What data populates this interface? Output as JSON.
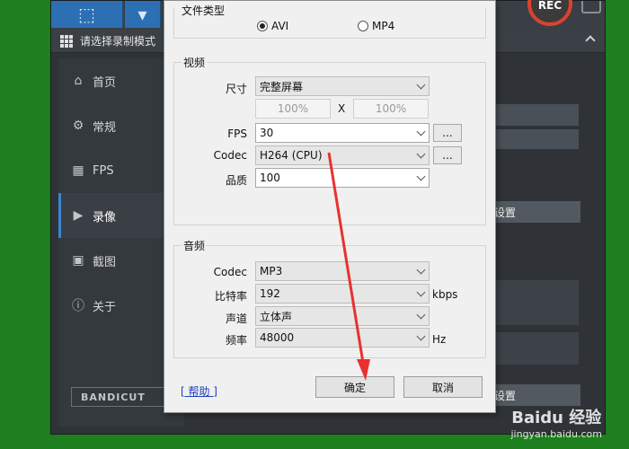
{
  "app": {
    "mode_bar_title": "请选择录制模式",
    "rec_label": "REC",
    "sidebar": [
      {
        "label": "首页",
        "icon": "home-icon"
      },
      {
        "label": "常规",
        "icon": "gear-icon"
      },
      {
        "label": "FPS",
        "icon": "fps-icon"
      },
      {
        "label": "录像",
        "icon": "video-icon",
        "active": true
      },
      {
        "label": "截图",
        "icon": "image-icon"
      },
      {
        "label": "关于",
        "icon": "info-icon"
      }
    ],
    "bandicut_logo": "BANDICUT",
    "right_button_1": "设置",
    "right_button_2": "设置"
  },
  "dialog": {
    "file_type_title": "文件类型",
    "format_options": [
      "AVI",
      "MP4"
    ],
    "format_selected": "AVI",
    "video": {
      "title": "视频",
      "size_label": "尺寸",
      "size_value": "完整屏幕",
      "width_pct": "100%",
      "x_label": "X",
      "height_pct": "100%",
      "fps_label": "FPS",
      "fps_value": "30",
      "codec_label": "Codec",
      "codec_value": "H264 (CPU)",
      "quality_label": "品质",
      "quality_value": "100",
      "dots": "..."
    },
    "audio": {
      "title": "音频",
      "codec_label": "Codec",
      "codec_value": "MP3",
      "bitrate_label": "比特率",
      "bitrate_value": "192",
      "bitrate_unit": "kbps",
      "channel_label": "声道",
      "channel_value": "立体声",
      "freq_label": "频率",
      "freq_value": "48000",
      "freq_unit": "Hz"
    },
    "help_label": "[ 帮助 ]",
    "ok_label": "确定",
    "cancel_label": "取消"
  },
  "watermark": {
    "main": "Baidu 经验",
    "sub": "jingyan.baidu.com"
  },
  "colors": {
    "desktop": "#1d7f1d",
    "arrow": "#e8312f",
    "accent": "#3a86d6"
  }
}
